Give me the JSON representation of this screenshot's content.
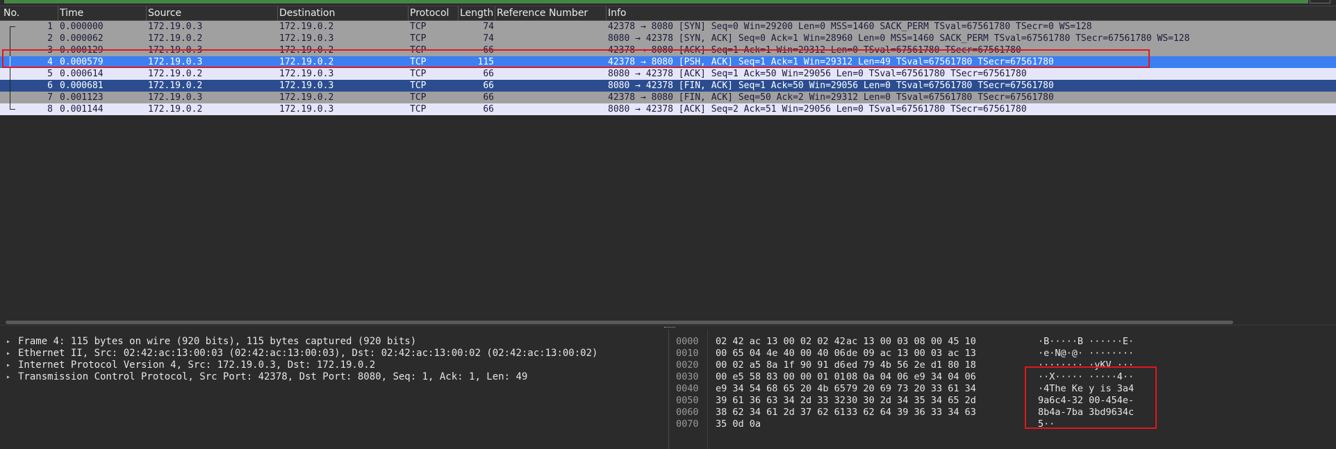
{
  "columns": {
    "no": "No.",
    "time": "Time",
    "source": "Source",
    "destination": "Destination",
    "protocol": "Protocol",
    "length": "Length",
    "reference": "Reference Number",
    "info": "Info"
  },
  "packets": [
    {
      "no": "1",
      "time": "0.000000",
      "src": "172.19.0.3",
      "dst": "172.19.0.2",
      "proto": "TCP",
      "len": "74",
      "ref": "",
      "info": "42378 → 8080 [SYN] Seq=0 Win=29200 Len=0 MSS=1460 SACK_PERM TSval=67561780 TSecr=0 WS=128"
    },
    {
      "no": "2",
      "time": "0.000062",
      "src": "172.19.0.2",
      "dst": "172.19.0.3",
      "proto": "TCP",
      "len": "74",
      "ref": "",
      "info": "8080 → 42378 [SYN, ACK] Seq=0 Ack=1 Win=28960 Len=0 MSS=1460 SACK_PERM TSval=67561780 TSecr=67561780 WS=128"
    },
    {
      "no": "3",
      "time": "0.000129",
      "src": "172.19.0.3",
      "dst": "172.19.0.2",
      "proto": "TCP",
      "len": "66",
      "ref": "",
      "info": "42378 → 8080 [ACK] Seq=1 Ack=1 Win=29312 Len=0 TSval=67561780 TSecr=67561780"
    },
    {
      "no": "4",
      "time": "0.000579",
      "src": "172.19.0.3",
      "dst": "172.19.0.2",
      "proto": "TCP",
      "len": "115",
      "ref": "",
      "info": "42378 → 8080 [PSH, ACK] Seq=1 Ack=1 Win=29312 Len=49 TSval=67561780 TSecr=67561780"
    },
    {
      "no": "5",
      "time": "0.000614",
      "src": "172.19.0.2",
      "dst": "172.19.0.3",
      "proto": "TCP",
      "len": "66",
      "ref": "",
      "info": "8080 → 42378 [ACK] Seq=1 Ack=50 Win=29056 Len=0 TSval=67561780 TSecr=67561780"
    },
    {
      "no": "6",
      "time": "0.000681",
      "src": "172.19.0.2",
      "dst": "172.19.0.3",
      "proto": "TCP",
      "len": "66",
      "ref": "",
      "info": "8080 → 42378 [FIN, ACK] Seq=1 Ack=50 Win=29056 Len=0 TSval=67561780 TSecr=67561780"
    },
    {
      "no": "7",
      "time": "0.001123",
      "src": "172.19.0.3",
      "dst": "172.19.0.2",
      "proto": "TCP",
      "len": "66",
      "ref": "",
      "info": "42378 → 8080 [FIN, ACK] Seq=50 Ack=2 Win=29312 Len=0 TSval=67561780 TSecr=67561780"
    },
    {
      "no": "8",
      "time": "0.001144",
      "src": "172.19.0.2",
      "dst": "172.19.0.3",
      "proto": "TCP",
      "len": "66",
      "ref": "",
      "info": "8080 → 42378 [ACK] Seq=2 Ack=51 Win=29056 Len=0 TSval=67561780 TSecr=67561780"
    }
  ],
  "details": [
    "Frame 4: 115 bytes on wire (920 bits), 115 bytes captured (920 bits)",
    "Ethernet II, Src: 02:42:ac:13:00:03 (02:42:ac:13:00:03), Dst: 02:42:ac:13:00:02 (02:42:ac:13:00:02)",
    "Internet Protocol Version 4, Src: 172.19.0.3, Dst: 172.19.0.2",
    "Transmission Control Protocol, Src Port: 42378, Dst Port: 8080, Seq: 1, Ack: 1, Len: 49"
  ],
  "bytes": [
    {
      "off": "0000",
      "h1": "02 42 ac 13 00 02 02 42",
      "h2": "ac 13 00 03 08 00 45 10",
      "a": "·B·····B ······E·"
    },
    {
      "off": "0010",
      "h1": "00 65 04 4e 40 00 40 06",
      "h2": "de 09 ac 13 00 03 ac 13",
      "a": "·e·N@·@· ········"
    },
    {
      "off": "0020",
      "h1": "00 02 a5 8a 1f 90 91 d6",
      "h2": "ed 79 4b 56 2e d1 80 18",
      "a": "········ ·yKV.···"
    },
    {
      "off": "0030",
      "h1": "00 e5 58 83 00 00 01 01",
      "h2": "08 0a 04 06 e9 34 04 06",
      "a": "··X····· ·····4··"
    },
    {
      "off": "0040",
      "h1": "e9 34 54 68 65 20 4b 65",
      "h2": "79 20 69 73 20 33 61 34",
      "a": "·4The Ke y is 3a4"
    },
    {
      "off": "0050",
      "h1": "39 61 36 63 34 2d 33 32",
      "h2": "30 30 2d 34 35 34 65 2d",
      "a": "9a6c4-32 00-454e-"
    },
    {
      "off": "0060",
      "h1": "38 62 34 61 2d 37 62 61",
      "h2": "33 62 64 39 36 33 34 63",
      "a": "8b4a-7ba 3bd9634c"
    },
    {
      "off": "0070",
      "h1": "35 0d 0a",
      "h2": "",
      "a": "5··"
    }
  ],
  "colors": {
    "row_gray": "#a0a0a0",
    "row_light": "#e6e6fa",
    "row_selected": "#3d7ff0",
    "row_dark_blue": "#2b4d8f",
    "annotation": "#e3161a"
  }
}
